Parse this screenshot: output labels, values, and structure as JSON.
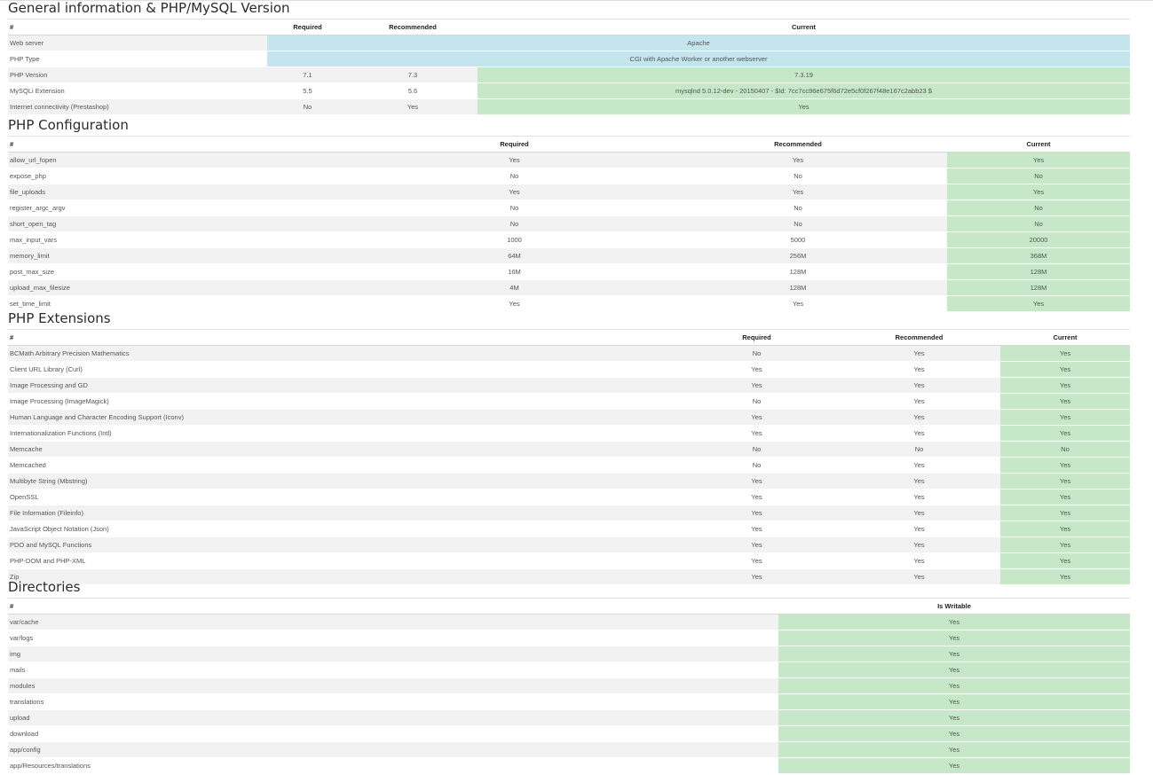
{
  "general": {
    "title": "General information & PHP/MySQL Version",
    "headers": [
      "#",
      "Required",
      "Recommended",
      "Current"
    ],
    "rows": [
      {
        "name": "Web server",
        "current": "Apache"
      },
      {
        "name": "PHP Type",
        "current": "CGI with Apache Worker or another webserver"
      },
      {
        "name": "PHP Version",
        "required": "7.1",
        "recommended": "7.3",
        "current": "7.3.19"
      },
      {
        "name": "MySQLi Extension",
        "required": "5.5",
        "recommended": "5.6",
        "current": "mysqlnd 5.0.12-dev - 20150407 - $Id: 7cc7cc96e675f6d72e5cf0f267f48e167c2abb23 $"
      },
      {
        "name": "Internet connectivity (Prestashop)",
        "required": "No",
        "recommended": "Yes",
        "current": "Yes"
      }
    ]
  },
  "php_config": {
    "title": "PHP Configuration",
    "headers": [
      "#",
      "Required",
      "Recommended",
      "Current"
    ],
    "rows": [
      {
        "name": "allow_url_fopen",
        "required": "Yes",
        "recommended": "Yes",
        "current": "Yes"
      },
      {
        "name": "expose_php",
        "required": "No",
        "recommended": "No",
        "current": "No"
      },
      {
        "name": "file_uploads",
        "required": "Yes",
        "recommended": "Yes",
        "current": "Yes"
      },
      {
        "name": "register_argc_argv",
        "required": "No",
        "recommended": "No",
        "current": "No"
      },
      {
        "name": "short_open_tag",
        "required": "No",
        "recommended": "No",
        "current": "No"
      },
      {
        "name": "max_input_vars",
        "required": "1000",
        "recommended": "5000",
        "current": "20000"
      },
      {
        "name": "memory_limit",
        "required": "64M",
        "recommended": "256M",
        "current": "368M"
      },
      {
        "name": "post_max_size",
        "required": "16M",
        "recommended": "128M",
        "current": "128M"
      },
      {
        "name": "upload_max_filesize",
        "required": "4M",
        "recommended": "128M",
        "current": "128M"
      },
      {
        "name": "set_time_limit",
        "required": "Yes",
        "recommended": "Yes",
        "current": "Yes"
      }
    ]
  },
  "php_extensions": {
    "title": "PHP Extensions",
    "headers": [
      "#",
      "Required",
      "Recommended",
      "Current"
    ],
    "rows": [
      {
        "name": "BCMath Arbitrary Precision Mathematics",
        "required": "No",
        "recommended": "Yes",
        "current": "Yes"
      },
      {
        "name": "Client URL Library (Curl)",
        "required": "Yes",
        "recommended": "Yes",
        "current": "Yes"
      },
      {
        "name": "Image Processing and GD",
        "required": "Yes",
        "recommended": "Yes",
        "current": "Yes"
      },
      {
        "name": "Image Processing (ImageMagick)",
        "required": "No",
        "recommended": "Yes",
        "current": "Yes"
      },
      {
        "name": "Human Language and Character Encoding Support (Iconv)",
        "required": "Yes",
        "recommended": "Yes",
        "current": "Yes"
      },
      {
        "name": "Internationalization Functions (Intl)",
        "required": "Yes",
        "recommended": "Yes",
        "current": "Yes"
      },
      {
        "name": "Memcache",
        "required": "No",
        "recommended": "No",
        "current": "No"
      },
      {
        "name": "Memcached",
        "required": "No",
        "recommended": "Yes",
        "current": "Yes"
      },
      {
        "name": "Multibyte String (Mbstring)",
        "required": "Yes",
        "recommended": "Yes",
        "current": "Yes"
      },
      {
        "name": "OpenSSL",
        "required": "Yes",
        "recommended": "Yes",
        "current": "Yes"
      },
      {
        "name": "File Information (Fileinfo)",
        "required": "Yes",
        "recommended": "Yes",
        "current": "Yes"
      },
      {
        "name": "JavaScript Object Notation (Json)",
        "required": "Yes",
        "recommended": "Yes",
        "current": "Yes"
      },
      {
        "name": "PDO and MySQL Functions",
        "required": "Yes",
        "recommended": "Yes",
        "current": "Yes"
      },
      {
        "name": "PHP-DOM and PHP-XML",
        "required": "Yes",
        "recommended": "Yes",
        "current": "Yes"
      },
      {
        "name": "Zip",
        "required": "Yes",
        "recommended": "Yes",
        "current": "Yes"
      }
    ]
  },
  "directories": {
    "title": "Directories",
    "headers": [
      "#",
      "Is Writable"
    ],
    "rows": [
      {
        "name": "var/cache",
        "writable": "Yes"
      },
      {
        "name": "var/logs",
        "writable": "Yes"
      },
      {
        "name": "img",
        "writable": "Yes"
      },
      {
        "name": "mails",
        "writable": "Yes"
      },
      {
        "name": "modules",
        "writable": "Yes"
      },
      {
        "name": "translations",
        "writable": "Yes"
      },
      {
        "name": "upload",
        "writable": "Yes"
      },
      {
        "name": "download",
        "writable": "Yes"
      },
      {
        "name": "app/config",
        "writable": "Yes"
      },
      {
        "name": "app/Resources/translations",
        "writable": "Yes"
      }
    ]
  },
  "colors": {
    "ok_background": "#c6e8c9",
    "info_background": "#c4e5ed",
    "row_stripe": "#f2f2f2"
  }
}
